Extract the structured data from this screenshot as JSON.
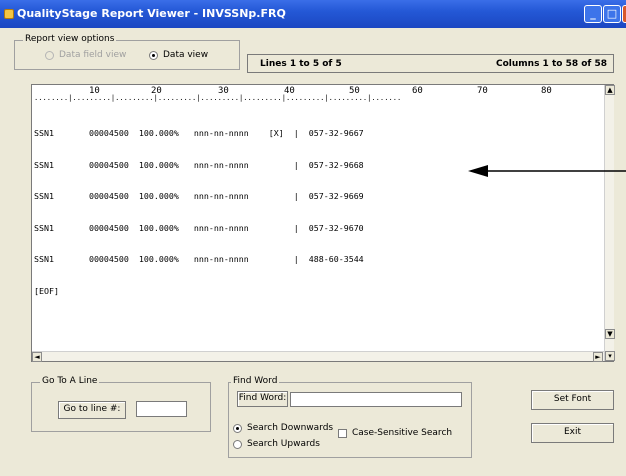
{
  "window": {
    "title": "QualityStage Report Viewer - INVSSNp.FRQ",
    "minimize_glyph": "_",
    "maximize_glyph": "□",
    "close_glyph": "✕"
  },
  "report_view_options": {
    "legend": "Report view options",
    "options": [
      {
        "label": "Data field view",
        "selected": false,
        "enabled": false
      },
      {
        "label": "Data view",
        "selected": true,
        "enabled": true
      }
    ]
  },
  "status": {
    "lines": "Lines  1  to 5  of 5",
    "columns": "Columns  1  to 58  of 58"
  },
  "ruler": {
    "ticks": [
      "10",
      "20",
      "30",
      "40",
      "50",
      "60",
      "70",
      "80"
    ],
    "dots": "........|.........|.........|.........|.........|.........|.........|.........|......."
  },
  "report_lines": [
    "SSN1       00004500  100.000%   nnn-nn-nnnn    [X]  |  057-32-9667",
    "SSN1       00004500  100.000%   nnn-nn-nnnn         |  057-32-9668",
    "SSN1       00004500  100.000%   nnn-nn-nnnn         |  057-32-9669",
    "SSN1       00004500  100.000%   nnn-nn-nnnn         |  057-32-9670",
    "SSN1       00004500  100.000%   nnn-nn-nnnn         |  488-60-3544",
    "[EOF]"
  ],
  "scroll_glyphs": {
    "up": "▲",
    "down": "▼",
    "left": "◄",
    "right": "►",
    "page_down": "▾"
  },
  "go_to_line": {
    "legend": "Go To A Line",
    "button": "Go to line #:",
    "value": ""
  },
  "find_word": {
    "legend": "Find Word",
    "button": "Find Word:",
    "value": "",
    "search_down": "Search Downwards",
    "search_up": "Search Upwards",
    "search_down_selected": true,
    "case_sensitive": "Case-Sensitive Search",
    "case_sensitive_checked": false
  },
  "buttons": {
    "set_font": "Set Font",
    "exit": "Exit"
  }
}
